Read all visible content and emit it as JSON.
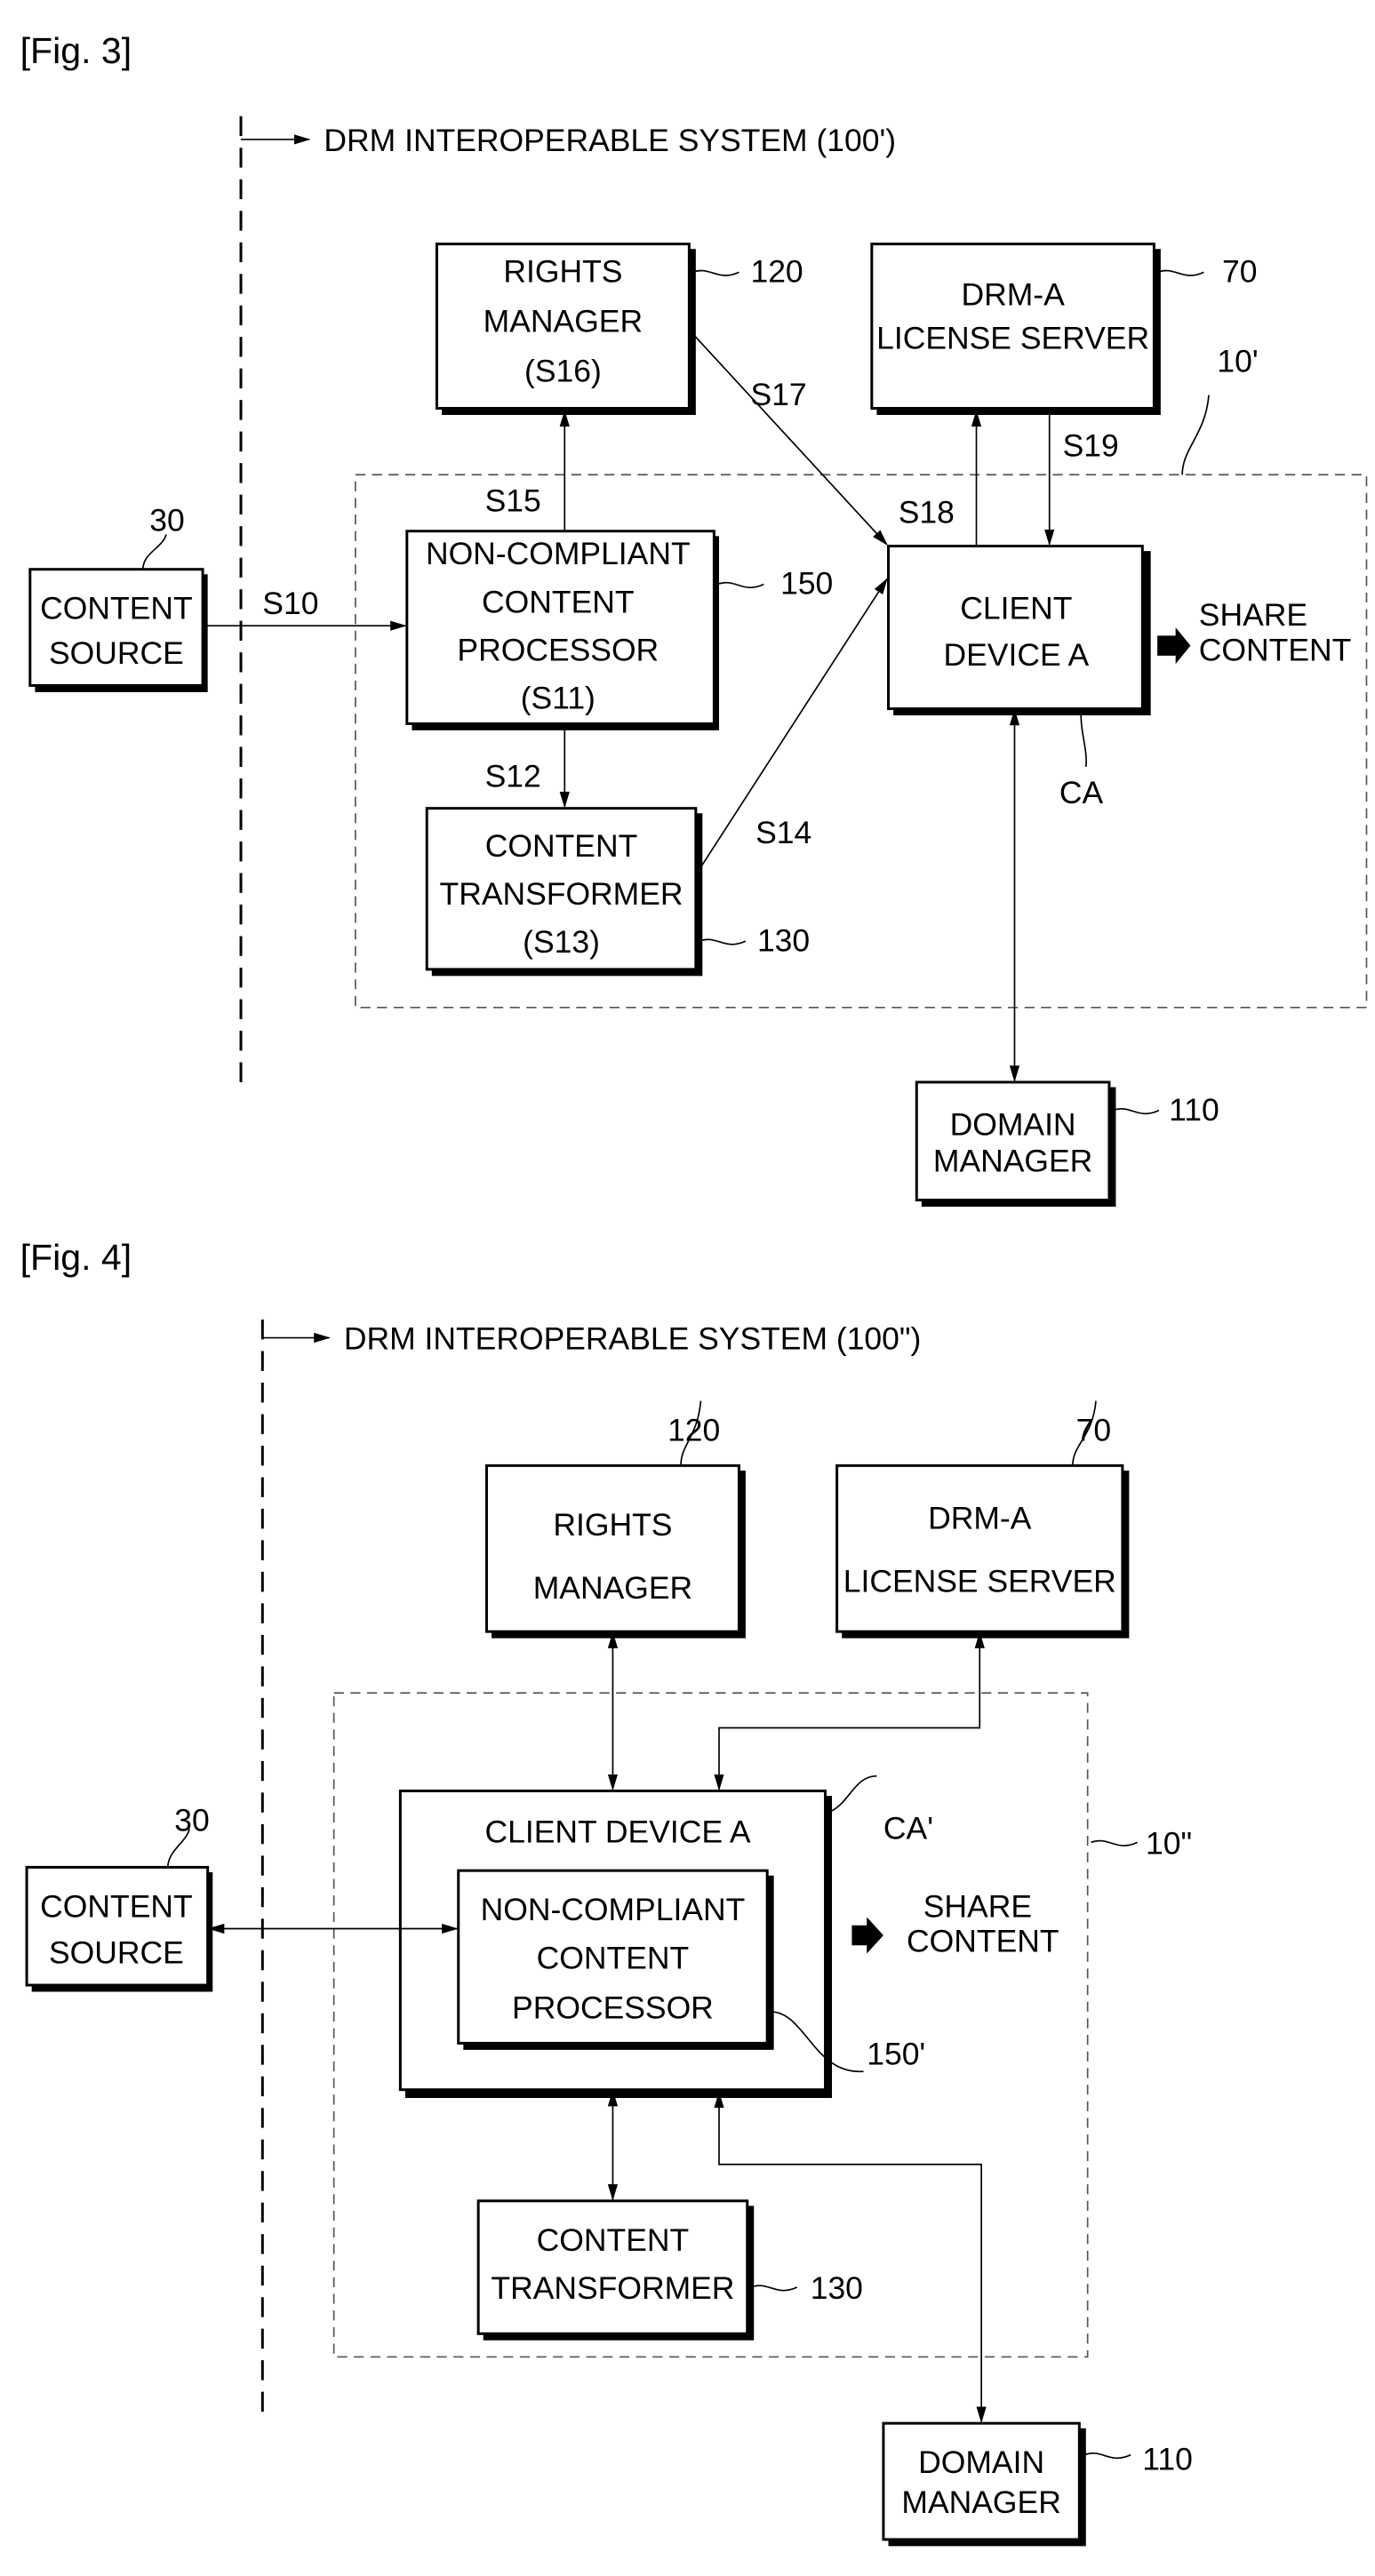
{
  "fig3": {
    "title": "[Fig. 3]",
    "system_label": "DRM INTEROPERABLE SYSTEM (100')",
    "rights_manager": {
      "lines": [
        "RIGHTS",
        "MANAGER",
        "(S16)"
      ],
      "ref": "120"
    },
    "license_server": {
      "lines": [
        "DRM-A",
        "LICENSE SERVER"
      ],
      "ref": "70"
    },
    "container_ref": "10'",
    "content_source": {
      "lines": [
        "CONTENT",
        "SOURCE"
      ],
      "ref": "30"
    },
    "processor": {
      "lines": [
        "NON-COMPLIANT",
        "CONTENT",
        "PROCESSOR",
        "(S11)"
      ],
      "ref": "150"
    },
    "client_device": {
      "lines": [
        "CLIENT",
        "DEVICE A"
      ],
      "ref": "CA"
    },
    "transformer": {
      "lines": [
        "CONTENT",
        "TRANSFORMER",
        "(S13)"
      ],
      "ref": "130"
    },
    "domain_manager": {
      "lines": [
        "DOMAIN",
        "MANAGER"
      ],
      "ref": "110"
    },
    "share": [
      "SHARE",
      "CONTENT"
    ],
    "steps": {
      "s10": "S10",
      "s12": "S12",
      "s14": "S14",
      "s15": "S15",
      "s17": "S17",
      "s18": "S18",
      "s19": "S19"
    }
  },
  "fig4": {
    "title": "[Fig. 4]",
    "system_label": "DRM INTEROPERABLE SYSTEM (100\")",
    "rights_manager": {
      "lines": [
        "RIGHTS",
        "MANAGER"
      ],
      "ref": "120"
    },
    "license_server": {
      "lines": [
        "DRM-A",
        "LICENSE SERVER"
      ],
      "ref": "70"
    },
    "container_ref": "10\"",
    "content_source": {
      "lines": [
        "CONTENT",
        "SOURCE"
      ],
      "ref": "30"
    },
    "client_device": {
      "label": "CLIENT DEVICE A",
      "ref": "CA'"
    },
    "processor": {
      "lines": [
        "NON-COMPLIANT",
        "CONTENT",
        "PROCESSOR"
      ],
      "ref": "150'"
    },
    "transformer": {
      "lines": [
        "CONTENT",
        "TRANSFORMER"
      ],
      "ref": "130"
    },
    "domain_manager": {
      "lines": [
        "DOMAIN",
        "MANAGER"
      ],
      "ref": "110"
    },
    "share": [
      "SHARE",
      "CONTENT"
    ]
  }
}
